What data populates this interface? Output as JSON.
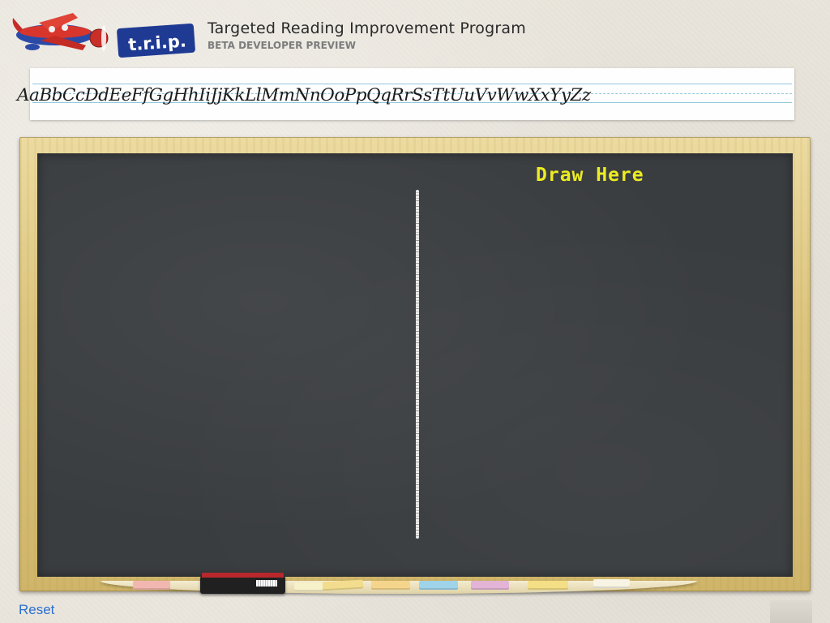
{
  "header": {
    "logo_text": "t.r.i.p.",
    "title": "Targeted Reading Improvement Program",
    "subtitle": "BETA DEVELOPER PREVIEW"
  },
  "alphabet_strip": {
    "text": "AaBbCcDdEeFfGgHhIiJjKkLlMmNnOoPpQqRrSsTtUuVvWwXxYyZz"
  },
  "board": {
    "label": "Draw Here",
    "label_color": "#ecec22",
    "board_color": "#3a3d40",
    "frame_color": "#dcc57f"
  },
  "tray": {
    "chalk_colors": [
      "#f2b7b0",
      "#f7f1c9",
      "#f2dc8e",
      "#f5d58c",
      "#9fd3ea",
      "#e3b4d6",
      "#f5df86",
      "#f7f4e4"
    ]
  },
  "footer": {
    "reset_label": "Reset",
    "accent": "#2a6fd1"
  }
}
